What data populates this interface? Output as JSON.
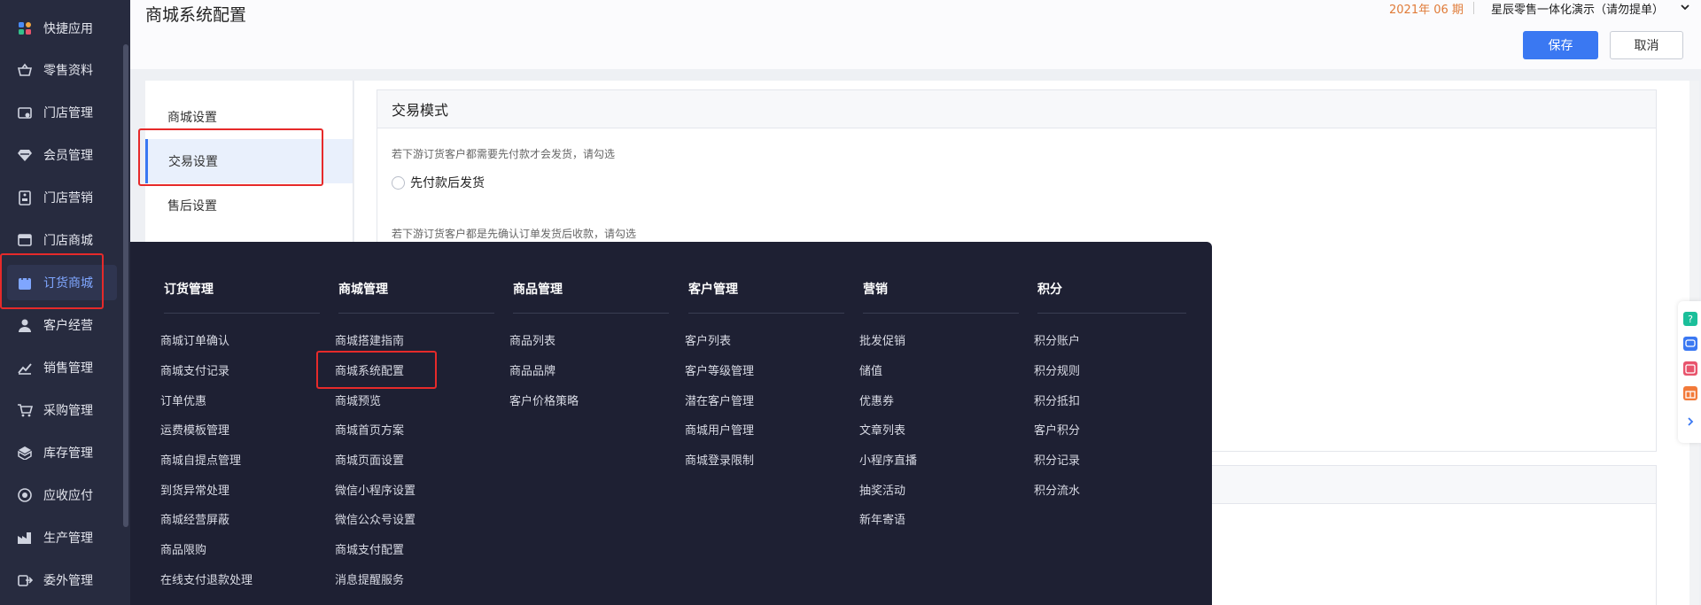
{
  "sidebar": {
    "items": [
      {
        "label": "快捷应用",
        "icon": "grid-apps-icon"
      },
      {
        "label": "零售资料",
        "icon": "basket-icon"
      },
      {
        "label": "门店管理",
        "icon": "store-icon"
      },
      {
        "label": "会员管理",
        "icon": "diamond-icon"
      },
      {
        "label": "门店营销",
        "icon": "tag-icon"
      },
      {
        "label": "门店商城",
        "icon": "shop-icon"
      },
      {
        "label": "订货商城",
        "icon": "shopping-bag-icon"
      },
      {
        "label": "客户经营",
        "icon": "user-icon"
      },
      {
        "label": "销售管理",
        "icon": "chart-icon"
      },
      {
        "label": "采购管理",
        "icon": "cart-icon"
      },
      {
        "label": "库存管理",
        "icon": "box-icon"
      },
      {
        "label": "应收应付",
        "icon": "money-icon"
      },
      {
        "label": "生产管理",
        "icon": "factory-icon"
      },
      {
        "label": "委外管理",
        "icon": "outsource-icon"
      }
    ],
    "active_index": 6
  },
  "header": {
    "title": "商城系统配置",
    "period": "2021年 06 期",
    "company": "星辰零售一体化演示（请勿提单）",
    "save_label": "保存",
    "cancel_label": "取消"
  },
  "left_nav": {
    "items": [
      "商城设置",
      "交易设置",
      "售后设置"
    ],
    "active_index": 1
  },
  "content": {
    "panel1_title": "交易模式",
    "hint1": "若下游订货客户都需要先付款才会发货，请勾选",
    "option1": "先付款后发货",
    "hint2": "若下游订货客户都是先确认订单发货后收款，请勾选"
  },
  "mega_menu": {
    "columns": [
      {
        "title": "订货管理",
        "items": [
          "商城订单确认",
          "商城支付记录",
          "订单优惠",
          "运费模板管理",
          "商城自提点管理",
          "到货异常处理",
          "商城经营屏蔽",
          "商品限购",
          "在线支付退款处理"
        ]
      },
      {
        "title": "商城管理",
        "items": [
          "商城搭建指南",
          "商城系统配置",
          "商城预览",
          "商城首页方案",
          "商城页面设置",
          "微信小程序设置",
          "微信公众号设置",
          "商城支付配置",
          "消息提醒服务"
        ]
      },
      {
        "title": "商品管理",
        "items": [
          "商品列表",
          "商品品牌",
          "客户价格策略"
        ]
      },
      {
        "title": "客户管理",
        "items": [
          "客户列表",
          "客户等级管理",
          "潜在客户管理",
          "商城用户管理",
          "商城登录限制"
        ]
      },
      {
        "title": "营销",
        "items": [
          "批发促销",
          "储值",
          "优惠券",
          "文章列表",
          "小程序直播",
          "抽奖活动",
          "新年寄语"
        ]
      },
      {
        "title": "积分",
        "items": [
          "积分账户",
          "积分规则",
          "积分抵扣",
          "客户积分",
          "积分记录",
          "积分流水"
        ]
      }
    ]
  },
  "colors": {
    "sidebar_bg": "#272b3f",
    "menu_bg": "#1e2033",
    "accent": "#3a78f2",
    "highlight": "#e62a2a",
    "period": "#e07b38"
  }
}
